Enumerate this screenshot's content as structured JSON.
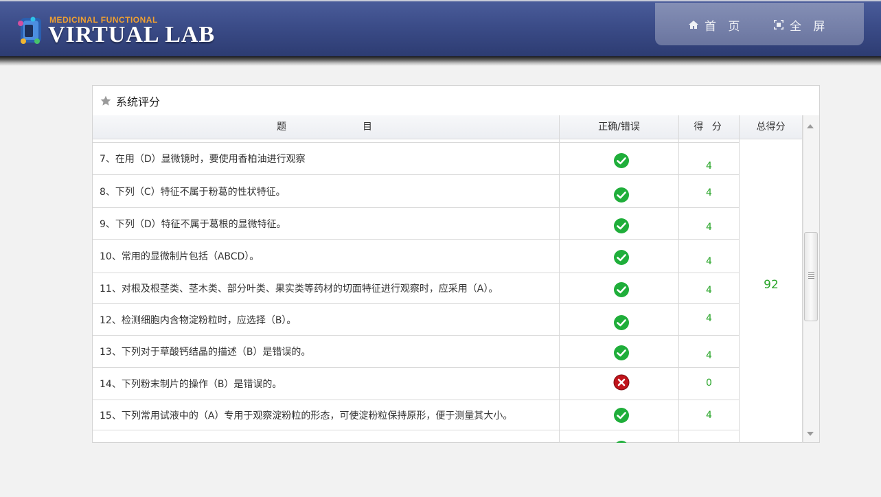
{
  "header": {
    "logo_small": "MEDICINAL FUNCTIONAL",
    "logo_big": "VIRTUAL LAB",
    "nav": [
      {
        "label": "首 页",
        "icon": "home-icon"
      },
      {
        "label": "全 屏",
        "icon": "fullscreen-icon"
      }
    ]
  },
  "panel": {
    "title": "系统评分",
    "columns": {
      "question_a": "题",
      "question_b": "目",
      "correct": "正确/错误",
      "score": "得 分",
      "total": "总得分"
    },
    "rows": [
      {
        "q": "7、在用（D）显微镜时，要使用香柏油进行观察",
        "correct": true,
        "score": "4"
      },
      {
        "q": "8、下列（C）特征不属于粉葛的性状特征。",
        "correct": true,
        "score": "4"
      },
      {
        "q": "9、下列（D）特征不属于葛根的显微特征。",
        "correct": true,
        "score": "4"
      },
      {
        "q": "10、常用的显微制片包括（ABCD）。",
        "correct": true,
        "score": "4"
      },
      {
        "q": "11、对根及根茎类、茎木类、部分叶类、果实类等药材的切面特征进行观察时，应采用（A）。",
        "correct": true,
        "score": "4"
      },
      {
        "q": "12、检测细胞内含物淀粉粒时，应选择（B）。",
        "correct": true,
        "score": "4"
      },
      {
        "q": "13、下列对于草酸钙结晶的描述（B）是错误的。",
        "correct": true,
        "score": "4"
      },
      {
        "q": "14、下列粉末制片的操作（B）是错误的。",
        "correct": false,
        "score": "0"
      },
      {
        "q": "15、下列常用试液中的（A）专用于观察淀粉粒的形态，可使淀粉粒保持原形，便于测量其大小。",
        "correct": true,
        "score": "4"
      }
    ],
    "total": "92"
  },
  "colors": {
    "correct_green": "#1fae3a",
    "wrong_red": "#c0141b",
    "score_green": "#2aa52a"
  }
}
